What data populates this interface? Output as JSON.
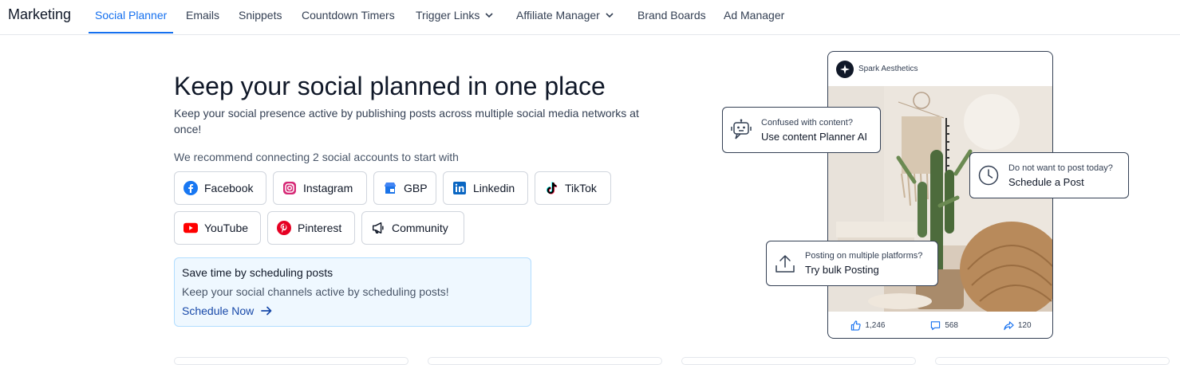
{
  "nav": {
    "brand": "Marketing",
    "items": [
      {
        "label": "Social Planner"
      },
      {
        "label": "Emails"
      },
      {
        "label": "Snippets"
      },
      {
        "label": "Countdown Timers"
      },
      {
        "label": "Trigger Links"
      },
      {
        "label": "Affiliate Manager"
      },
      {
        "label": "Brand Boards"
      },
      {
        "label": "Ad Manager"
      }
    ]
  },
  "hero": {
    "title": "Keep your social planned in one place",
    "subtitle": "Keep your social presence active by publishing posts across multiple social media networks at once!",
    "recommend": "We recommend connecting 2 social accounts to start with"
  },
  "social_buttons": [
    {
      "label": "Facebook",
      "icon": "facebook-icon",
      "color": "#1877f2"
    },
    {
      "label": "Instagram",
      "icon": "instagram-icon",
      "color": "#e1306c"
    },
    {
      "label": "GBP",
      "icon": "gbp-icon",
      "color": "#4285f4"
    },
    {
      "label": "Linkedin",
      "icon": "linkedin-icon",
      "color": "#0a66c2"
    },
    {
      "label": "TikTok",
      "icon": "tiktok-icon",
      "color": "#000000"
    },
    {
      "label": "YouTube",
      "icon": "youtube-icon",
      "color": "#ff0000"
    },
    {
      "label": "Pinterest",
      "icon": "pinterest-icon",
      "color": "#e60023"
    },
    {
      "label": "Community",
      "icon": "megaphone-icon",
      "color": "#101828"
    }
  ],
  "promo": {
    "title": "Save time by scheduling posts",
    "text": "Keep your social channels active by scheduling posts!",
    "link": "Schedule Now"
  },
  "preview": {
    "account": "Spark Aesthetics",
    "likes": "1,246",
    "comments": "568",
    "shares": "120"
  },
  "callouts": {
    "ai": {
      "small": "Confused with content?",
      "big": "Use content Planner AI"
    },
    "schedule": {
      "small": "Do not want to post today?",
      "big": "Schedule a Post"
    },
    "bulk": {
      "small": "Posting on multiple platforms?",
      "big": "Try bulk Posting"
    }
  },
  "colors": {
    "accent": "#1570ef",
    "promo_bg": "#eff8ff",
    "link": "#1849a9"
  }
}
